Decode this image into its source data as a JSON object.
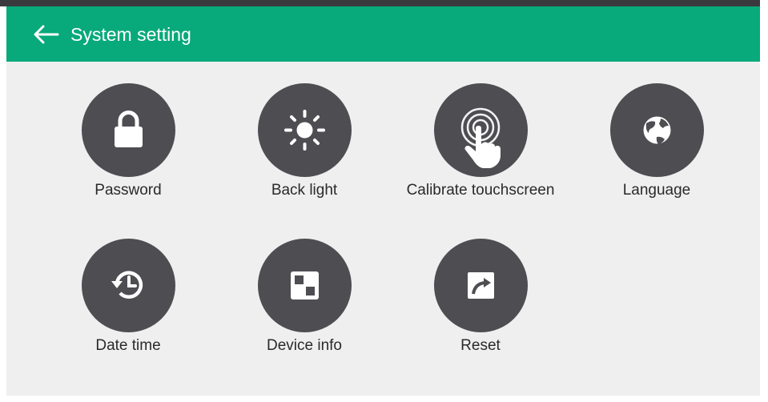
{
  "header": {
    "title": "System setting",
    "back_icon": "arrow-left-icon",
    "bg_color": "#08a97b"
  },
  "tiles": [
    {
      "label": "Password",
      "icon": "lock-icon"
    },
    {
      "label": "Back light",
      "icon": "brightness-icon"
    },
    {
      "label": "Calibrate touchscreen",
      "icon": "touch-hand-icon"
    },
    {
      "label": "Language",
      "icon": "globe-icon"
    },
    {
      "label": "Date time",
      "icon": "clock-history-icon"
    },
    {
      "label": "Device info",
      "icon": "device-info-icon"
    },
    {
      "label": "Reset",
      "icon": "reset-arrow-icon"
    }
  ],
  "colors": {
    "accent": "#08a97b",
    "circle": "#4d4d52",
    "background": "#efefef"
  }
}
